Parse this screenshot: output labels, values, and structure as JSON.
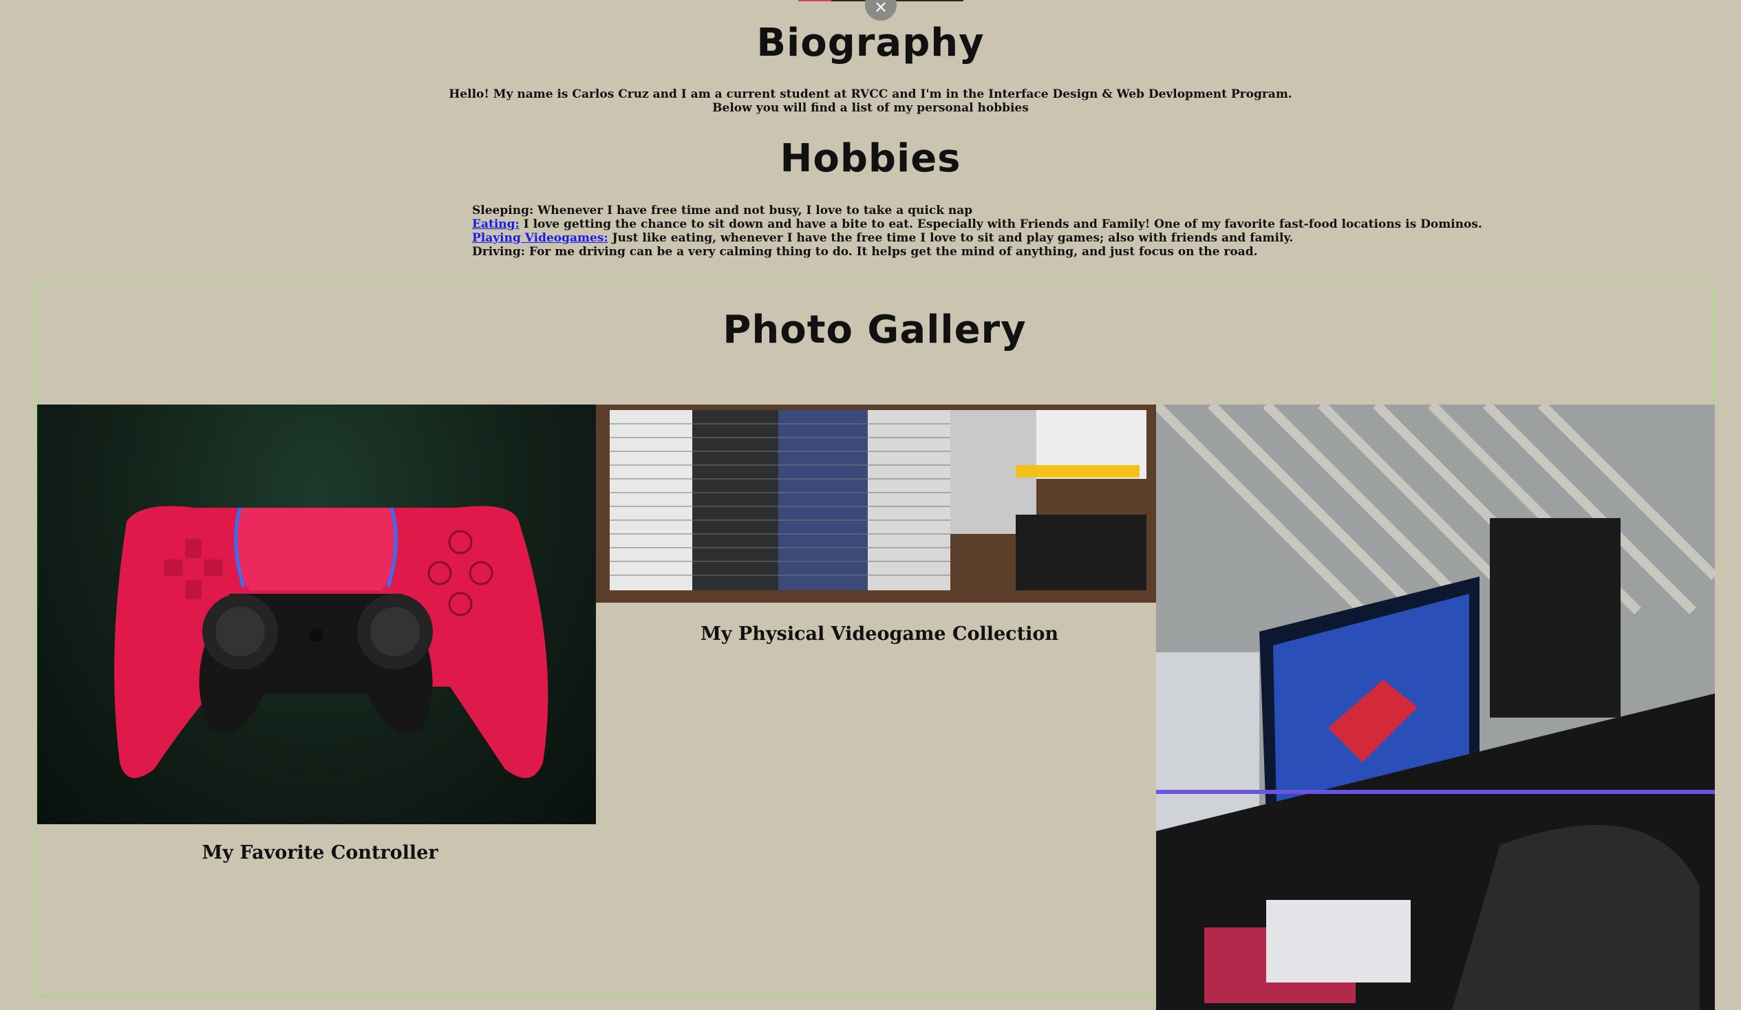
{
  "overlay": {
    "close_icon": "✕"
  },
  "biography": {
    "title": "Biography",
    "line1": "Hello! My name is Carlos Cruz and I am a current student at RVCC and I'm in the Interface Design & Web Devlopment Program.",
    "line2": "Below you will find a list of my personal hobbies"
  },
  "hobbies": {
    "title": "Hobbies",
    "items": [
      {
        "label": "",
        "text": "Sleeping: Whenever I have free time and not busy, I love to take a quick nap"
      },
      {
        "label": "Eating:",
        "text": " I love getting the chance to sit down and have a bite to eat. Especially with Friends and Family! One of my favorite fast-food locations is Dominos."
      },
      {
        "label": "Playing Videogames:",
        "text": " Just like eating, whenever I have the free time I love to sit and play games; also with friends and family."
      },
      {
        "label": "",
        "text": "Driving: For me driving can be a very calming thing to do. It helps get the mind of anything, and just focus on the road."
      }
    ]
  },
  "gallery": {
    "title": "Photo Gallery",
    "photos": [
      {
        "caption": "My Favorite Controller"
      },
      {
        "caption": "My Physical Videogame Collection"
      },
      {
        "caption": ""
      }
    ]
  }
}
